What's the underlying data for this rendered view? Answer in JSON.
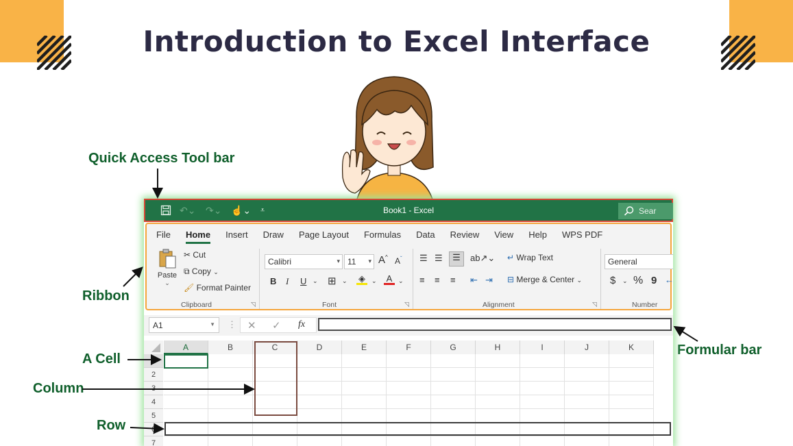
{
  "slide": {
    "title": "Introduction to Excel Interface"
  },
  "annotations": {
    "quick_access": "Quick Access Tool bar",
    "ribbon": "Ribbon",
    "a_cell": "A Cell",
    "column": "Column",
    "row": "Row",
    "formula_bar": "Formular bar"
  },
  "excel": {
    "window_title": "Book1  -  Excel",
    "search_placeholder": "Sear",
    "tabs": [
      "File",
      "Home",
      "Insert",
      "Draw",
      "Page Layout",
      "Formulas",
      "Data",
      "Review",
      "View",
      "Help",
      "WPS PDF"
    ],
    "active_tab": "Home",
    "clipboard": {
      "paste": "Paste",
      "cut": "Cut",
      "copy": "Copy",
      "format_painter": "Format Painter",
      "label": "Clipboard"
    },
    "font": {
      "name": "Calibri",
      "size": "11",
      "bold": "B",
      "italic": "I",
      "underline": "U",
      "grow": "A",
      "shrink": "A",
      "label": "Font"
    },
    "alignment": {
      "wrap_text": "Wrap Text",
      "merge_center": "Merge & Center",
      "label": "Alignment"
    },
    "number": {
      "format": "General",
      "currency": "$",
      "percent": "%",
      "comma": "9",
      "label": "Number"
    },
    "formula_bar": {
      "name_box": "A1",
      "fx": "fx"
    },
    "columns": [
      "A",
      "B",
      "C",
      "D",
      "E",
      "F",
      "G",
      "H",
      "I",
      "J",
      "K"
    ],
    "rows": [
      "1",
      "2",
      "3",
      "4",
      "5",
      "6",
      "7"
    ]
  },
  "colors": {
    "excel_green": "#217346",
    "annotation_green": "#0f5f2b",
    "accent_orange": "#f9b347",
    "title_navy": "#2c2a44"
  }
}
